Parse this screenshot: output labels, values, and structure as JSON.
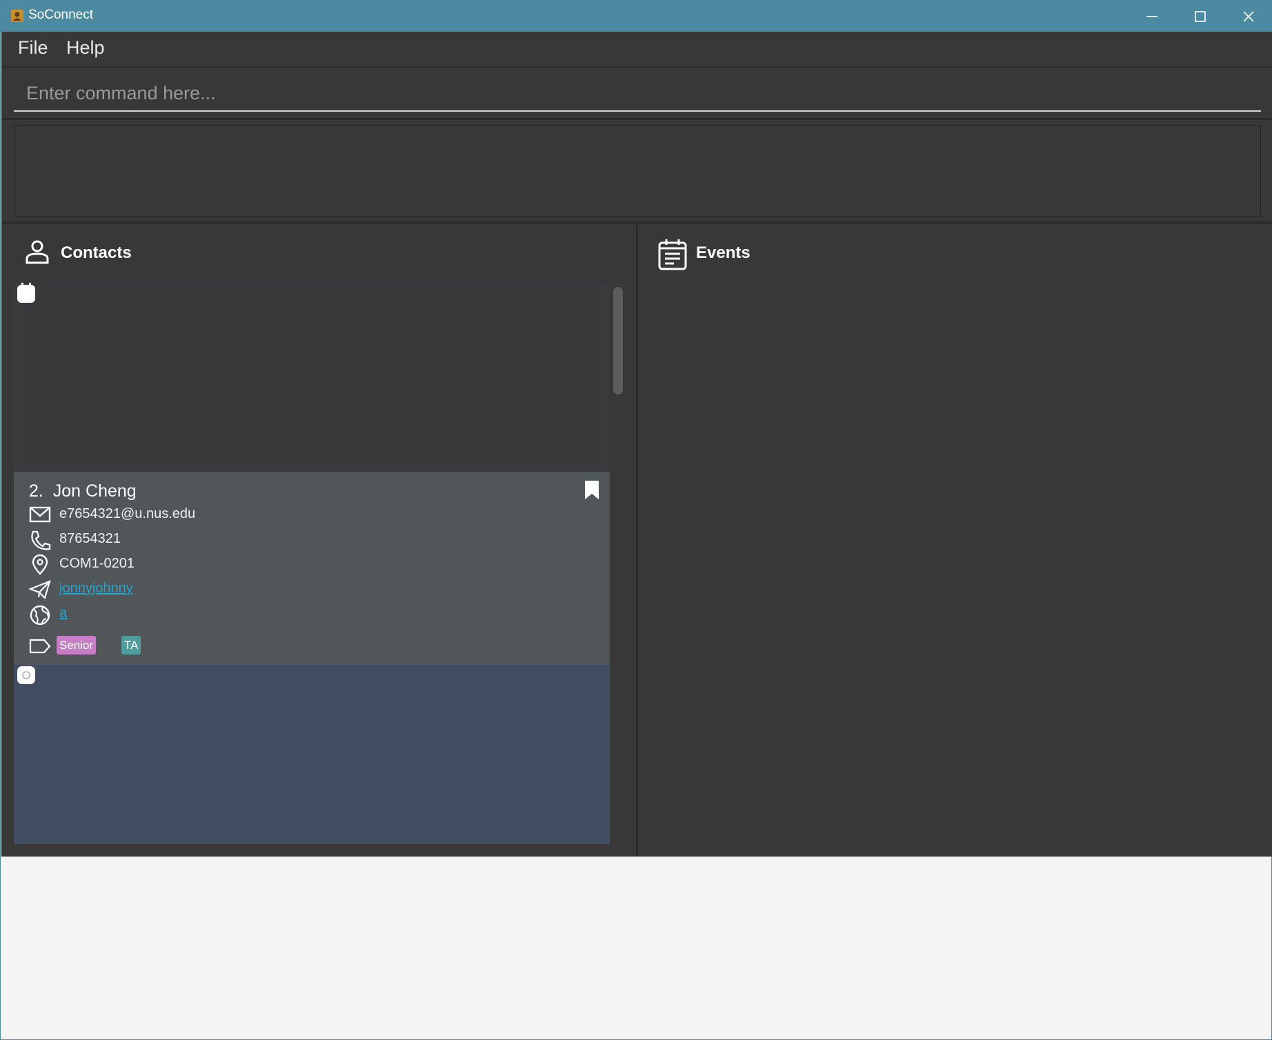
{
  "window": {
    "title": "SoConnect"
  },
  "menu": {
    "items": [
      "File",
      "Help"
    ]
  },
  "command": {
    "placeholder": "Enter command here..."
  },
  "contacts": {
    "title": "Contacts",
    "cards": [
      {
        "index": "2.",
        "name": "Jon Cheng",
        "email": "e7654321@u.nus.edu",
        "phone": "87654321",
        "address": "COM1-0201",
        "telegram": "jonnyjohnny",
        "website": "a",
        "tags": [
          "Senior",
          "TA"
        ],
        "bookmarked": true
      }
    ]
  },
  "events": {
    "title": "Events"
  },
  "colors": {
    "titlebar": "#4b8aa0",
    "link": "#29a3cc",
    "tag_senior": "#c67ec7",
    "tag_ta": "#4f9c9c",
    "selected_card": "#414c60"
  },
  "icons": [
    "app-icon",
    "minimize-icon",
    "maximize-icon",
    "close-icon",
    "person-icon",
    "calendar-icon",
    "bookmark-icon",
    "email-icon",
    "phone-icon",
    "location-icon",
    "telegram-icon",
    "globe-icon",
    "tag-icon"
  ]
}
